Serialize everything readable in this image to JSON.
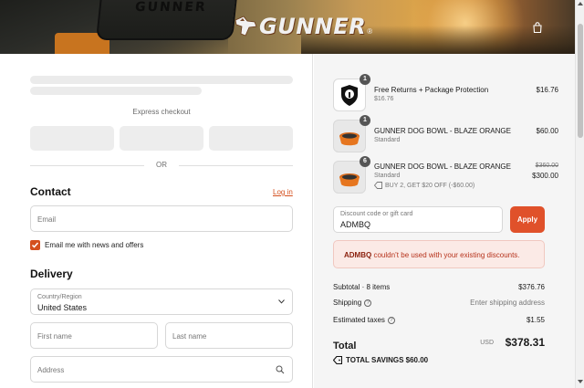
{
  "brand": {
    "name": "GUNNER",
    "reg": "®",
    "crate_text": "GUNNER"
  },
  "colors": {
    "accent": "#d4501e",
    "apply": "#e0512a",
    "error_bg": "#fbeae6",
    "error_text": "#b6321b"
  },
  "checkout": {
    "express_label": "Express checkout",
    "or_label": "OR",
    "contact": {
      "title": "Contact",
      "login_label": "Log in",
      "email_placeholder": "Email",
      "newsletter_label": "Email me with news and offers",
      "newsletter_checked": true
    },
    "delivery": {
      "title": "Delivery",
      "country_label": "Country/Region",
      "country_value": "United States",
      "first_name_placeholder": "First name",
      "last_name_placeholder": "Last name",
      "address_placeholder": "Address"
    }
  },
  "summary": {
    "items": [
      {
        "qty": "1",
        "name": "Free Returns + Package Protection",
        "sub": "$16.76",
        "price": "$16.76",
        "icon": "shield-lock-icon"
      },
      {
        "qty": "1",
        "name": "GUNNER DOG BOWL - BLAZE ORANGE",
        "sub": "Standard",
        "price": "$60.00",
        "icon": "dog-bowl-icon"
      },
      {
        "qty": "6",
        "name": "GUNNER DOG BOWL - BLAZE ORANGE",
        "sub": "Standard",
        "price_original": "$360.00",
        "price": "$300.00",
        "discount": "BUY 2, GET $20 OFF (-$60.00)",
        "icon": "dog-bowl-icon"
      }
    ],
    "discount": {
      "label": "Discount code or gift card",
      "value": "ADMBQ",
      "apply_label": "Apply",
      "error_code": "ADMBQ",
      "error_message": " couldn’t be used with your existing discounts."
    },
    "subtotal_label": "Subtotal · 8 items",
    "subtotal_value": "$376.76",
    "shipping_label": "Shipping",
    "shipping_value": "Enter shipping address",
    "taxes_label": "Estimated taxes",
    "taxes_value": "$1.55",
    "total_label": "Total",
    "total_currency": "USD",
    "total_value": "$378.31",
    "savings_label": "TOTAL SAVINGS",
    "savings_value": "$60.00"
  }
}
